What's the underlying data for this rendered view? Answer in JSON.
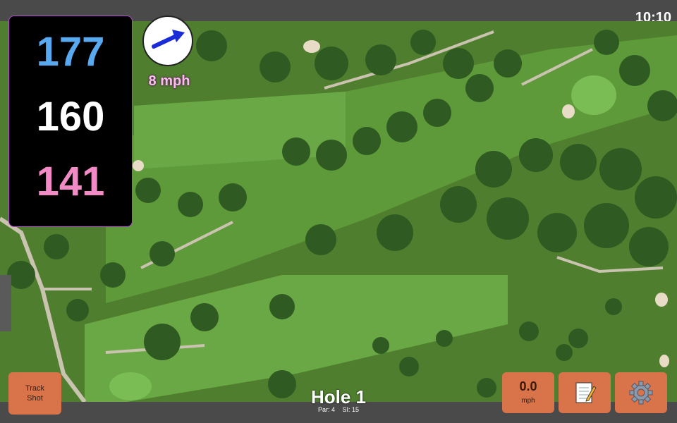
{
  "status": {
    "clock": "10:10"
  },
  "distances": {
    "back": "177",
    "middle": "160",
    "front": "141"
  },
  "wind": {
    "speed": "8 mph",
    "icon": "arrow-icon"
  },
  "hole": {
    "title": "Hole 1",
    "par": "Par: 4",
    "stroke_index": "SI: 15"
  },
  "buttons": {
    "track_shot": "Track\nShot",
    "speed_value": "0.0",
    "speed_unit": "mph",
    "notes_icon": "notepad-icon",
    "settings_icon": "gear-icon"
  },
  "colors": {
    "back": "#58a9f0",
    "middle": "#ffffff",
    "front": "#f28ac6",
    "button": "#d8734a",
    "panel_border": "#b24bd0"
  }
}
